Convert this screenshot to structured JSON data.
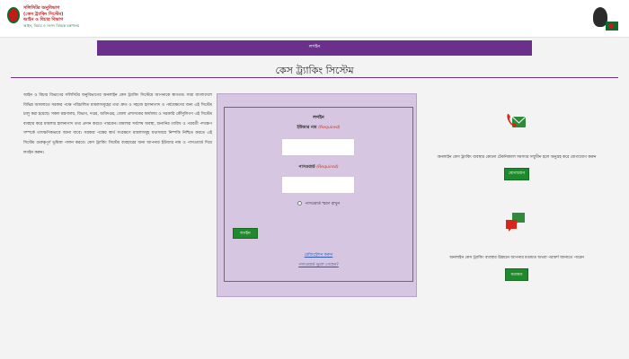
{
  "header": {
    "ministry_line1": "সলিসিটর অনুবিভাগ",
    "ministry_line2": "(কেস ট্র্যাকিং সিস্টেম)",
    "ministry_line3": "আইন ও বিচার বিভাগ",
    "ministry_line4": "আইন, বিচার ও সংসদ বিষয়ক মন্ত্রণালয়"
  },
  "nav": {
    "label": "লগইন"
  },
  "page": {
    "title": "কেস ট্র্যাকিং সিস্টেম"
  },
  "description": "আইন ও বিচার বিভাগের সলিসিটর অনুবিভাগের অনলাইন কেস ট্র্যাকিং সিস্টেমে আপনাকে স্বাগতম। সারা বাংলাদেশে বিভিন্ন আদালতে সরকার পক্ষে পরিচালিত মামলাসমূহের তথ্য দ্রুত ও সহজে হালনাগাদ ও পর্যবেক্ষণের জন্য এই সিস্টেম চালু করা হয়েছে। সকল মন্ত্রণালয়, বিভাগ, দপ্তর, অধিদপ্তর, জেলা প্রশাসকের কার্যালয় ও সরকারি কৌঁসুলিগণ এই সিস্টেম ব্যবহার করে মামলার হালনাগাদ তথ্য প্রদান করতে পারবেন। মামলার সর্বশেষ অবস্থা, শুনানির তারিখ ও পরবর্তী পদক্ষেপ সম্পর্কে তাৎক্ষণিকভাবে জানা যাবে। সরকার পক্ষের স্বার্থ সংরক্ষণে মামলাসমূহ যথাসময়ে নিষ্পত্তি নিশ্চিত করতে এই সিস্টেম গুরুত্বপূর্ণ ভূমিকা পালন করবে। কেস ট্র্যাকিং সিস্টেম ব্যবহারের জন্য আপনার ইউজার নাম ও পাসওয়ার্ড দিয়ে লগইন করুন।",
  "login": {
    "heading": "লগইন",
    "username_label": "ইউজার নাম",
    "username_required": "(Required)",
    "username_value": "",
    "password_label": "পাসওয়ার্ড",
    "password_required": "(Required)",
    "password_value": "",
    "remember_label": "পাসওয়ার্ড স্মরণ রাখুন",
    "button_label": "লগইন",
    "register_link": "রেজিস্ট্রেশন করুন",
    "forgot_link": "পাসওয়ার্ড ভুলে গেছেন?"
  },
  "contact": {
    "text": "অনলাইন কেস ট্র্যাকিং ব্যবস্থার কোনো টেকনিক্যাল সমস্যার সম্মুখীন হলে অনুগ্রহ করে যোগাযোগ করুন",
    "button_label": "যোগাযোগ"
  },
  "feedback": {
    "text": "অনলাইন কেস ট্র্যাকিং ব্যবস্থার উন্নয়নে আপনার মতামত অথবা পরামর্শ জানাতে পারেন",
    "button_label": "মতামত"
  },
  "colors": {
    "brand_purple": "#6b2f8c",
    "button_green": "#1f8a2d",
    "panel_lavender": "#d6c6e2",
    "required_red": "#c0392b"
  }
}
